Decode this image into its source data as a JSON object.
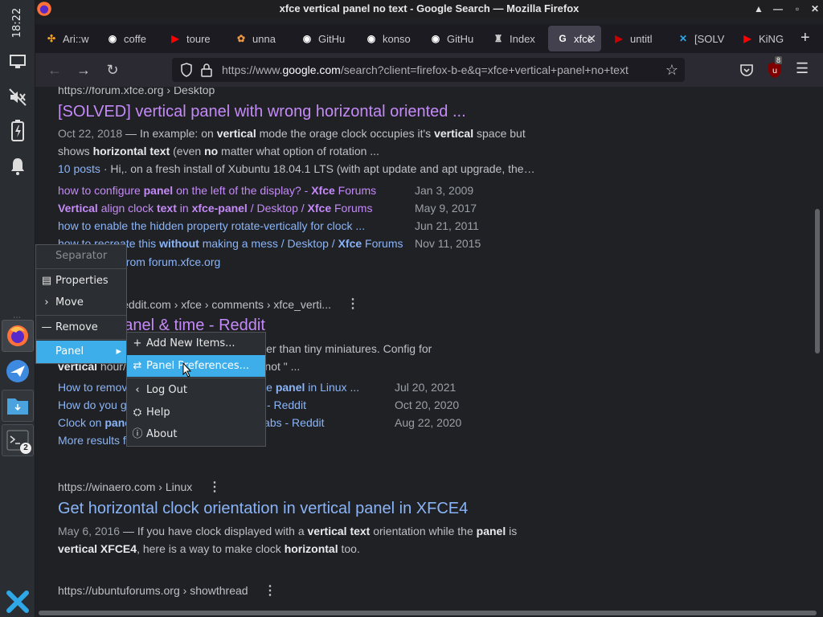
{
  "panel": {
    "clock": "18:22",
    "icons": [
      "monitor-icon",
      "speaker-muted-icon",
      "battery-icon",
      "bell-icon"
    ],
    "launchers": [
      "firefox-icon",
      "bird-icon",
      "file-manager-icon",
      "terminal-icon"
    ],
    "terminal_badge": "2"
  },
  "window": {
    "title": "xfce vertical panel no text - Google Search — Mozilla Firefox"
  },
  "tabs": [
    {
      "label": "Ari::w",
      "icon": "apps-icon",
      "color": "#f5a623"
    },
    {
      "label": "coffe",
      "icon": "github-icon",
      "color": "#ffffff"
    },
    {
      "label": "toure",
      "icon": "youtube-icon",
      "color": "#ff0000"
    },
    {
      "label": "unna",
      "icon": "pinwheel-icon",
      "color": "#e94"
    },
    {
      "label": "GitHu",
      "icon": "github-icon",
      "color": "#ffffff"
    },
    {
      "label": "konso",
      "icon": "github-icon",
      "color": "#ffffff"
    },
    {
      "label": "GitHu",
      "icon": "github-icon",
      "color": "#ffffff"
    },
    {
      "label": "Index",
      "icon": "index-icon",
      "color": "#cccccc"
    },
    {
      "label": "xfce",
      "icon": "google-icon",
      "color": "#ffffff"
    },
    {
      "label": "untitl",
      "icon": "youtube-icon",
      "color": "#cc0000"
    },
    {
      "label": "[SOLV",
      "icon": "xfce-icon",
      "color": "#2ea8e6"
    },
    {
      "label": "KiNG",
      "icon": "youtube-icon",
      "color": "#ff0000"
    }
  ],
  "urlbar": {
    "prefix": "https://www.",
    "domain": "google.com",
    "path": "/search?client=firefox-b-e&q=xfce+vertical+panel+no+text"
  },
  "toolbar": {
    "ublock_badge": "8"
  },
  "results": {
    "r1_cite": "https://forum.xfce.org › Desktop",
    "r1_title": "[SOLVED] vertical panel with wrong horizontal oriented ...",
    "r1_line2_date": "Oct 22, 2018",
    "r1_posts": "10 posts",
    "r1_posts_text": " · Hi,. on a fresh install of Xubuntu 18.04.1 LTS (with apt update and apt upgrade, the…",
    "r1_sub": [
      {
        "text": "how to configure panel on the left of the display? - Xfce Forums",
        "date": "Jan 3, 2009"
      },
      {
        "text": "Vertical align clock text in xfce-panel / Desktop / Xfce Forums",
        "date": "May 9, 2017"
      },
      {
        "text": "how to enable the hidden property rotate-vertically for clock ...",
        "date": "Jun 21, 2011"
      },
      {
        "text": "how to recreate this without making a mess / Desktop / Xfce Forums",
        "date": "Nov 11, 2015"
      }
    ],
    "r1_more": "More results from forum.xfce.org",
    "r2_cite": "https://www.reddit.com › xfce › comments › xfce_verti...",
    "r2_title": "Vertical panel & time - Reddit",
    "r2_snip1": "Text labels with window names feels clearer than tiny miniatures. Config for",
    "r2_snip2a": "vertical",
    "r2_snip2b": " hour/minute clock \"desktop bar\", not \" ...",
    "r2_sub": [
      {
        "text": "How to remove the text next to icons in the panel in Linux ...",
        "date": "Jul 20, 2021"
      },
      {
        "text": "How do you get a vertical panel? : r/xfce - Reddit",
        "date": "Oct 20, 2020"
      },
      {
        "text": "Clock on panel with vertical / horizontal labs - Reddit",
        "date": "Aug 22, 2020"
      }
    ],
    "r2_more": "More results from www.reddit.com",
    "r3_cite": "https://winaero.com › Linux",
    "r3_title": "Get horizontal clock orientation in vertical panel in XFCE4",
    "r3_date": "May 6, 2016",
    "r4_cite": "https://ubuntuforums.org › showthread"
  },
  "context_menu": {
    "header": "Separator",
    "items": [
      {
        "label": "Properties",
        "icon": "properties-icon",
        "glyph": "▤"
      },
      {
        "label": "Move",
        "icon": "move-icon",
        "glyph": "›"
      },
      {
        "label": "Remove",
        "icon": "remove-icon",
        "glyph": "—"
      },
      {
        "label": "Panel",
        "icon": "",
        "glyph": ""
      }
    ],
    "submenu_arrow": "▸"
  },
  "panel_submenu": {
    "items": [
      {
        "label": "Add New Items...",
        "icon": "plus-icon",
        "glyph": "+"
      },
      {
        "label": "Panel Preferences...",
        "icon": "preferences-icon",
        "glyph": "⇄"
      },
      {
        "label": "Log Out",
        "icon": "logout-icon",
        "glyph": "‹"
      },
      {
        "label": "Help",
        "icon": "help-icon",
        "glyph": "⛭"
      },
      {
        "label": "About",
        "icon": "about-icon",
        "glyph": "ⓘ"
      }
    ]
  },
  "colors": {
    "link": "#8ab4f8",
    "visited": "#c58af9",
    "highlight": "#3daee9"
  }
}
